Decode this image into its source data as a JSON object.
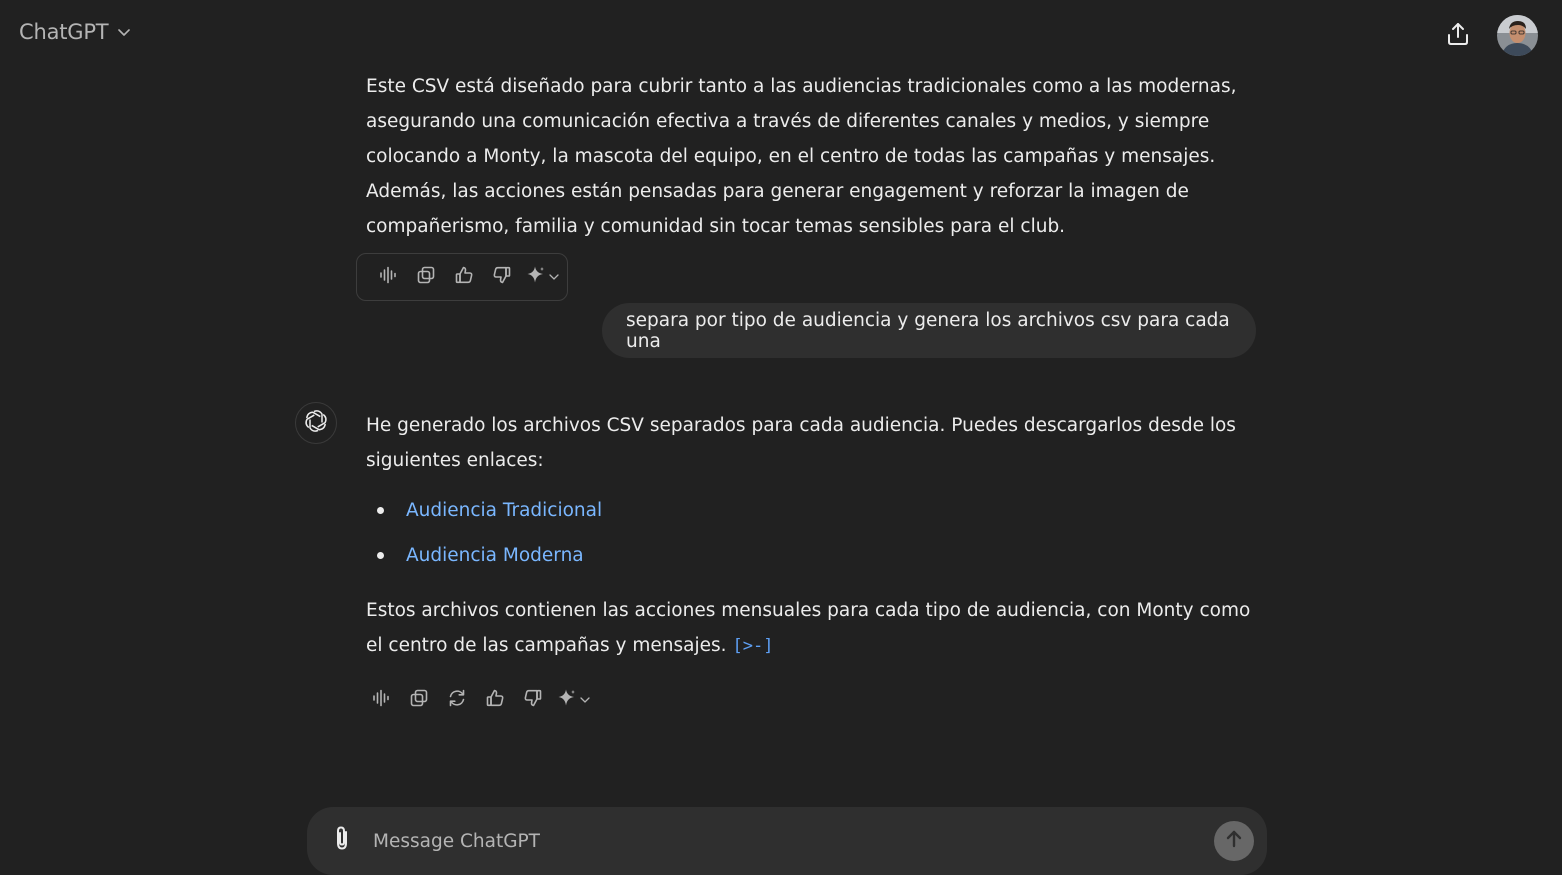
{
  "header": {
    "model_title": "ChatGPT"
  },
  "messages": {
    "assistant_prev": {
      "text": "Este CSV está diseñado para cubrir tanto a las audiencias tradicionales como a las modernas, asegurando una comunicación efectiva a través de diferentes canales y medios, y siempre colocando a Monty, la mascota del equipo, en el centro de todas las campañas y mensajes. Además, las acciones están pensadas para generar engagement y reforzar la imagen de compañerismo, familia y comunidad sin tocar temas sensibles para el club."
    },
    "user": {
      "text": "separa por tipo de audiencia y genera los archivos csv para cada una"
    },
    "assistant": {
      "intro": "He generado los archivos CSV separados para cada audiencia. Puedes descargarlos desde los siguientes enlaces:",
      "links": [
        {
          "label": "Audiencia Tradicional"
        },
        {
          "label": "Audiencia Moderna"
        }
      ],
      "outro": "Estos archivos contienen las acciones mensuales para cada tipo de audiencia, con Monty como el centro de las campañas y mensajes.",
      "code_link": "[>-]"
    }
  },
  "composer": {
    "placeholder": "Message ChatGPT"
  },
  "colors": {
    "background": "#212121",
    "bubble": "#2f2f2f",
    "link": "#7ab7ff",
    "text": "#ececec",
    "muted": "#b4b4b4"
  },
  "icons": {
    "header": [
      "chevron-down-icon",
      "share-icon",
      "avatar"
    ],
    "actions_prev": [
      "read-aloud-icon",
      "copy-icon",
      "thumbs-up-icon",
      "thumbs-down-icon",
      "sparkle-icon"
    ],
    "actions_last": [
      "read-aloud-icon",
      "copy-icon",
      "regenerate-icon",
      "thumbs-up-icon",
      "thumbs-down-icon",
      "sparkle-icon"
    ],
    "composer": [
      "paperclip-icon",
      "arrow-up-icon"
    ],
    "assistant_avatar": "openai-logo-icon"
  }
}
